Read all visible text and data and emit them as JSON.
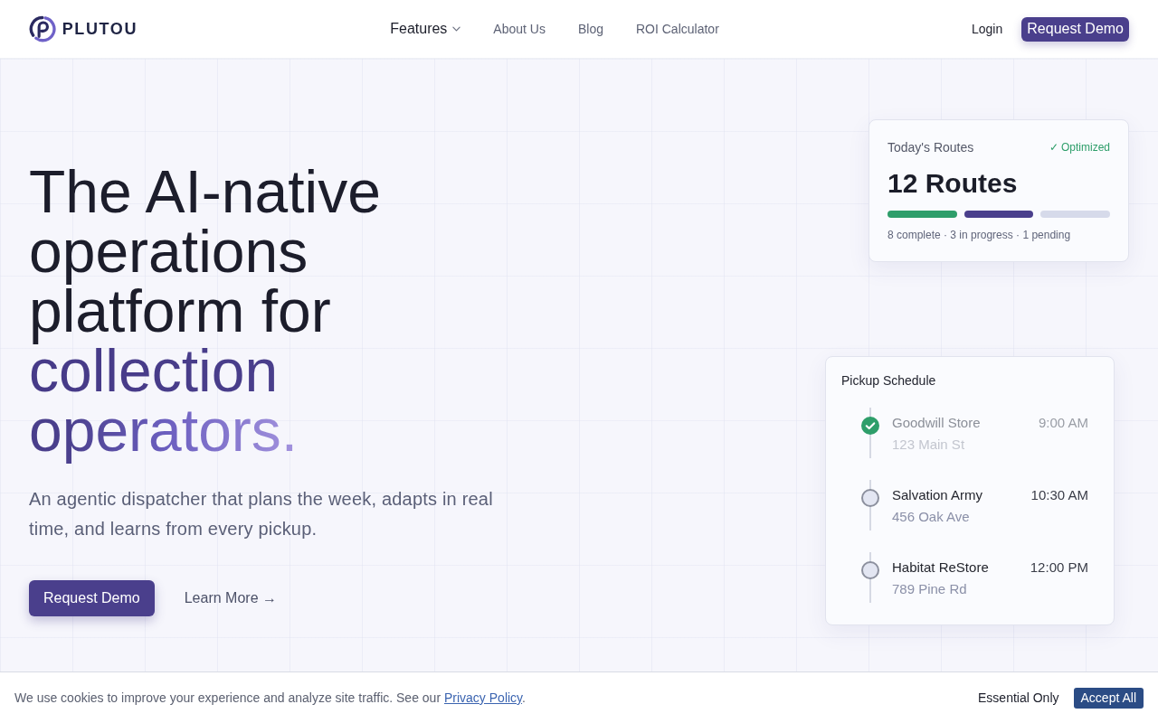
{
  "header": {
    "logo": {
      "wordmark": "PLUTOU"
    },
    "nav": [
      {
        "label": "Features",
        "kind": "dropdown"
      },
      {
        "label": "About Us",
        "kind": "link"
      },
      {
        "label": "Blog",
        "kind": "link"
      },
      {
        "label": "ROI Calculator",
        "kind": "link"
      }
    ],
    "login": "Login",
    "cta": "Request Demo"
  },
  "hero": {
    "headline": {
      "lead": "The AI-native operations platform for",
      "highlight": "collection operators."
    },
    "subtitle": "An agentic dispatcher that plans the week, adapts in real time, and learns from every pickup.",
    "primary_button": "Request Demo",
    "secondary_link": "Learn More →"
  },
  "routes_card": {
    "title": "Today's Routes",
    "badge": "✓ Optimized",
    "count": "12 Routes",
    "segments": [
      {
        "color": "#2e9e6a"
      },
      {
        "color": "#4a3f8c"
      },
      {
        "color": "#d6daea"
      }
    ],
    "summary": "8 complete · 3 in progress · 1 pending"
  },
  "schedule_card": {
    "title": "Pickup Schedule",
    "stops": [
      {
        "name": "Goodwill Store",
        "address": "123 Main St",
        "time": "9:00 AM",
        "done": true
      },
      {
        "name": "Salvation Army",
        "address": "456 Oak Ave",
        "time": "10:30 AM",
        "done": false
      },
      {
        "name": "Habitat ReStore",
        "address": "789 Pine Rd",
        "time": "12:00 PM",
        "done": false
      }
    ]
  },
  "cookie_banner": {
    "text": "We use cookies to improve your experience and analyze site traffic. See our",
    "link": "Privacy Policy",
    "after": ".",
    "buttons": [
      {
        "label": "Essential Only",
        "kind": "secondary"
      },
      {
        "label": "Accept All",
        "kind": "primary"
      }
    ]
  }
}
